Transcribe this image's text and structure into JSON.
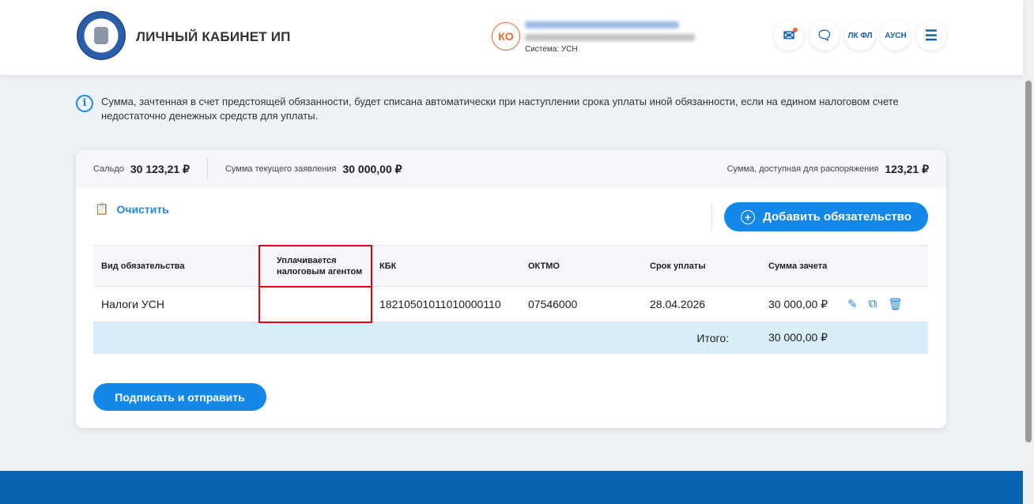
{
  "header": {
    "title": "ЛИЧНЫЙ КАБИНЕТ ИП",
    "avatar_initials": "КО",
    "system": "Система: УСН",
    "buttons": {
      "mail": "mail",
      "chat": "chat",
      "lk_fl": "ЛК ФЛ",
      "ausn": "АУСН",
      "menu": "menu"
    }
  },
  "info": {
    "text": "Сумма, зачтенная в счет предстоящей обязанности, будет списана автоматически при наступлении срока уплаты иной обязанности, если на едином налоговом счете недостаточно денежных средств для уплаты."
  },
  "summary": {
    "saldo_label": "Сальдо",
    "saldo_value": "30 123,21 ₽",
    "current_label": "Сумма текущего заявления",
    "current_value": "30 000,00 ₽",
    "available_label": "Сумма, доступная для распоряжения",
    "available_value": "123,21 ₽"
  },
  "actions": {
    "clear": "Очистить",
    "add": "Добавить обязательство",
    "sign": "Подписать и отправить"
  },
  "table": {
    "headers": [
      "Вид обязательства",
      "Уплачивается налоговым агентом",
      "КБК",
      "ОКТМО",
      "Срок уплаты",
      "Сумма зачета"
    ],
    "rows": [
      {
        "type": "Налоги УСН",
        "agent": "",
        "kbk": "18210501011010000110",
        "oktmo": "07546000",
        "due": "28.04.2026",
        "amount": "30 000,00 ₽"
      }
    ],
    "total_label": "Итого:",
    "total_value": "30 000,00 ₽"
  },
  "colors": {
    "accent": "#1488e8",
    "highlight": "#e3000f",
    "footer": "#0a64b0"
  }
}
